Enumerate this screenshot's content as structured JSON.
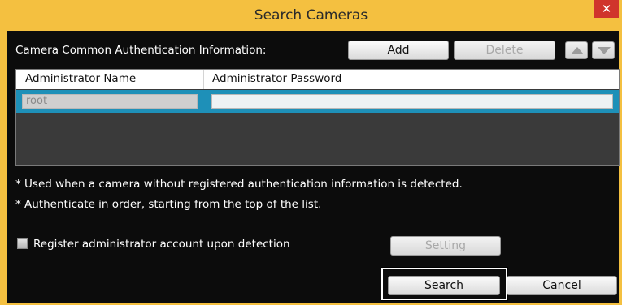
{
  "window": {
    "title": "Search Cameras",
    "close_glyph": "✕",
    "title_bar_color": "#f4c040",
    "close_color": "#d0342c"
  },
  "auth_section": {
    "label": "Camera Common Authentication Information:",
    "add_button": "Add",
    "delete_button": "Delete",
    "move_up_icon": "triangle-up-icon",
    "move_down_icon": "triangle-down-icon"
  },
  "table": {
    "columns": [
      "Administrator Name",
      "Administrator Password"
    ],
    "rows": [
      {
        "name": "root",
        "password": ""
      }
    ],
    "selected_row_color": "#1e90b8"
  },
  "notes": [
    "* Used when a camera without registered authentication information is detected.",
    "* Authenticate in order, starting from the top of the list."
  ],
  "register": {
    "checkbox_label": "Register administrator account upon detection",
    "checked": false,
    "setting_button": "Setting"
  },
  "footer": {
    "search_button": "Search",
    "cancel_button": "Cancel"
  }
}
